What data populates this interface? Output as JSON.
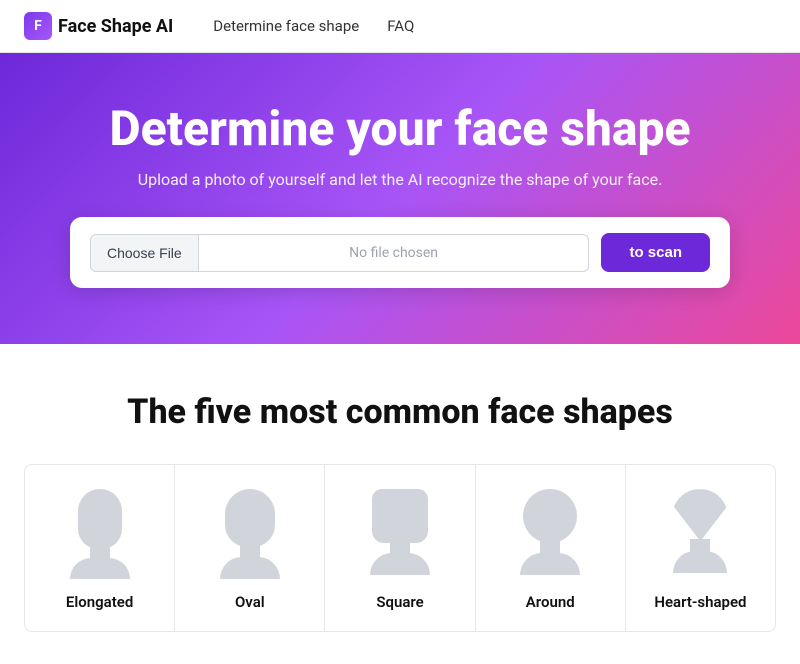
{
  "nav": {
    "logo_text": "Face Shape AI",
    "links": [
      {
        "id": "determine",
        "label": "Determine face shape"
      },
      {
        "id": "faq",
        "label": "FAQ"
      }
    ]
  },
  "hero": {
    "title": "Determine your face shape",
    "subtitle": "Upload a photo of yourself and let the AI recognize the shape of your face.",
    "choose_file_label": "Choose File",
    "file_placeholder": "No file chosen",
    "scan_button_label": "to scan"
  },
  "shapes_section": {
    "title": "The five most common face shapes",
    "shapes": [
      {
        "id": "elongated",
        "label": "Elongated"
      },
      {
        "id": "oval",
        "label": "Oval"
      },
      {
        "id": "square",
        "label": "Square"
      },
      {
        "id": "around",
        "label": "Around"
      },
      {
        "id": "heart",
        "label": "Heart-shaped"
      }
    ]
  }
}
